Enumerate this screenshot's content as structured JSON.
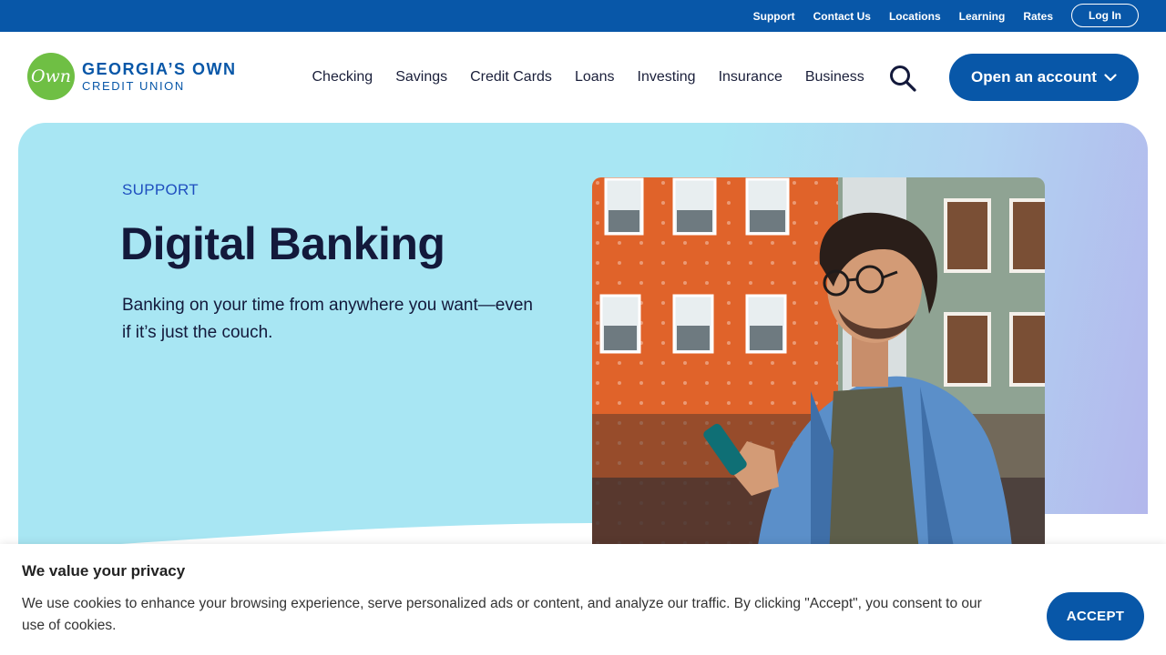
{
  "utility_nav": {
    "links": [
      "Support",
      "Contact Us",
      "Locations",
      "Learning",
      "Rates"
    ],
    "login_label": "Log In"
  },
  "header": {
    "logo_mark": "Own",
    "logo_line1": "GEORGIA’S OWN",
    "logo_line2": "CREDIT UNION",
    "nav_items": [
      "Checking",
      "Savings",
      "Credit Cards",
      "Loans",
      "Investing",
      "Insurance",
      "Business"
    ],
    "search_icon": "search-icon",
    "cta_label": "Open an account"
  },
  "hero": {
    "eyebrow": "SUPPORT",
    "title": "Digital Banking",
    "subtitle": "Banking on your time from anywhere you want—even if it’s just the couch."
  },
  "cookie_banner": {
    "title": "We value your privacy",
    "text": "We use cookies to enhance your browsing experience, serve personalized ads or content, and analyze our traffic. By clicking \"Accept\", you consent to our use of cookies.",
    "accept_label": "ACCEPT"
  },
  "colors": {
    "brand_blue": "#0857a8",
    "logo_green": "#6fbf44",
    "hero_bg": "#a8e6f3",
    "heading_dark": "#13193b"
  }
}
